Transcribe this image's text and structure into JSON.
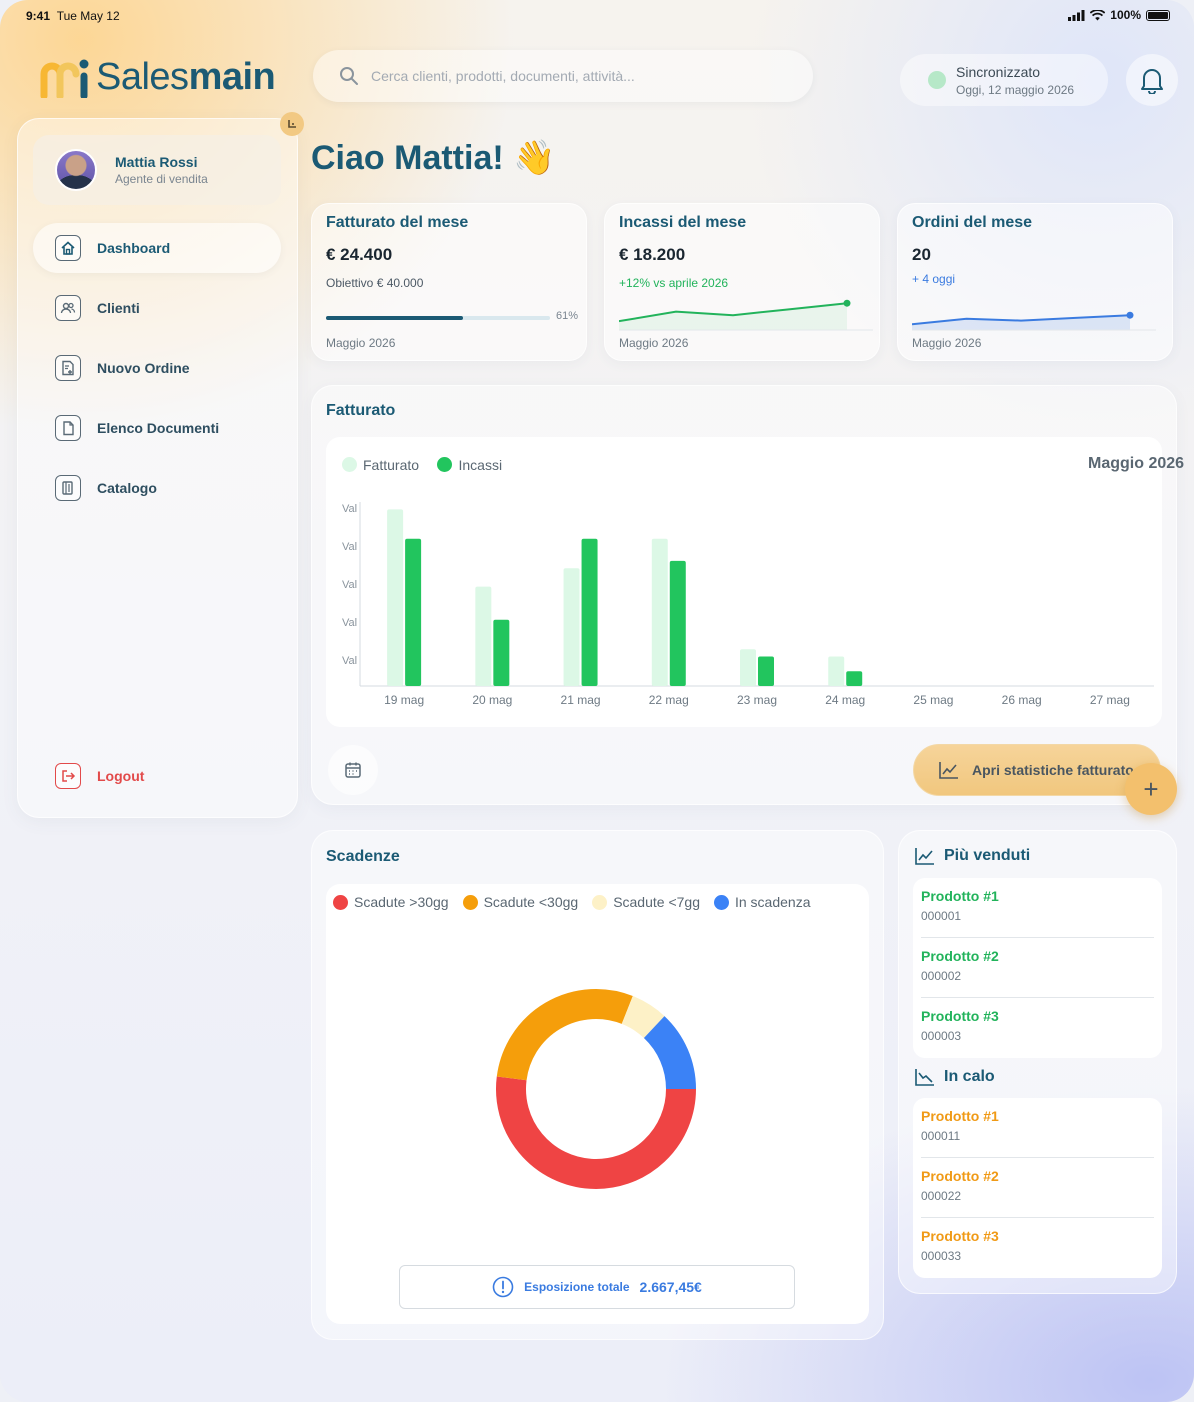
{
  "status_bar": {
    "time": "9:41",
    "date": "Tue May 12",
    "battery": "100%"
  },
  "logo": {
    "prefix": "Sales",
    "suffix": "main"
  },
  "search": {
    "placeholder": "Cerca clienti, prodotti, documenti, attività..."
  },
  "sync": {
    "title": "Sincronizzato",
    "subtitle": "Oggi, 12 maggio 2026"
  },
  "user": {
    "name": "Mattia Rossi",
    "role": "Agente di vendita"
  },
  "sidebar": {
    "items": [
      {
        "label": "Dashboard",
        "icon": "home-icon",
        "active": true
      },
      {
        "label": "Clienti",
        "icon": "users-icon"
      },
      {
        "label": "Nuovo Ordine",
        "icon": "new-order-icon"
      },
      {
        "label": "Elenco Documenti",
        "icon": "documents-icon"
      },
      {
        "label": "Catalogo",
        "icon": "catalog-icon"
      }
    ],
    "logout": "Logout"
  },
  "greeting": "Ciao Mattia! 👋",
  "kpis": {
    "fatturato": {
      "title": "Fatturato del mese",
      "value": "€ 24.400",
      "sub": "Obiettivo € 40.000",
      "progress_pct": 61,
      "progress_label": "61%",
      "date": "Maggio 2026"
    },
    "incassi": {
      "title": "Incassi del mese",
      "value": "€ 18.200",
      "sub": "+12% vs aprile 2026",
      "date": "Maggio 2026",
      "sparkline": [
        0.2,
        0.6,
        0.45,
        0.7,
        0.95
      ]
    },
    "ordini": {
      "title": "Ordini del mese",
      "value": "20",
      "sub": "+ 4 oggi",
      "date": "Maggio 2026",
      "sparkline": [
        0.1,
        0.4,
        0.3,
        0.45,
        0.6
      ]
    }
  },
  "fatturato_section": {
    "title": "Fatturato",
    "month": "Maggio 2026",
    "stats_button": "Apri statistiche fatturato",
    "colors": {
      "fatturato": "#dcf8e6",
      "incassi": "#22c55e"
    }
  },
  "chart_data": {
    "type": "bar",
    "title": "Fatturato",
    "categories": [
      "19 mag",
      "20 mag",
      "21 mag",
      "22 mag",
      "23 mag",
      "24 mag",
      "25 mag",
      "26 mag",
      "27 mag"
    ],
    "series": [
      {
        "name": "Fatturato",
        "values": [
          4.8,
          2.7,
          3.2,
          4.0,
          1.0,
          0.8,
          0,
          0,
          0
        ]
      },
      {
        "name": "Incassi",
        "values": [
          4.0,
          1.8,
          4.0,
          3.4,
          0.8,
          0.4,
          0,
          0,
          0
        ]
      }
    ],
    "ytick_labels": [
      "Val",
      "Val",
      "Val",
      "Val",
      "Val"
    ],
    "ylim": [
      0,
      5
    ],
    "legend": "top-left"
  },
  "scadenze": {
    "title": "Scadenze",
    "legend": [
      {
        "label": "Scadute >30gg",
        "color": "#ef4444"
      },
      {
        "label": "Scadute <30gg",
        "color": "#f59e0b"
      },
      {
        "label": "Scadute <7gg",
        "color": "#fdf1c7"
      },
      {
        "label": "In scadenza",
        "color": "#3b82f6"
      }
    ],
    "exposure_label": "Esposizione totale",
    "exposure_value": "2.667,45€"
  },
  "donut_data": {
    "type": "pie",
    "slices": [
      {
        "name": "Scadute >30gg",
        "value": 52
      },
      {
        "name": "Scadute <30gg",
        "value": 29
      },
      {
        "name": "Scadute <7gg",
        "value": 6
      },
      {
        "name": "In scadenza",
        "value": 13
      }
    ]
  },
  "top_products": {
    "title": "Più venduti",
    "items": [
      {
        "name": "Prodotto #1",
        "code": "000001"
      },
      {
        "name": "Prodotto #2",
        "code": "000002"
      },
      {
        "name": "Prodotto #3",
        "code": "000003"
      }
    ]
  },
  "declining_products": {
    "title": "In calo",
    "items": [
      {
        "name": "Prodotto #1",
        "code": "000011"
      },
      {
        "name": "Prodotto #2",
        "code": "000022"
      },
      {
        "name": "Prodotto #3",
        "code": "000033"
      }
    ]
  }
}
